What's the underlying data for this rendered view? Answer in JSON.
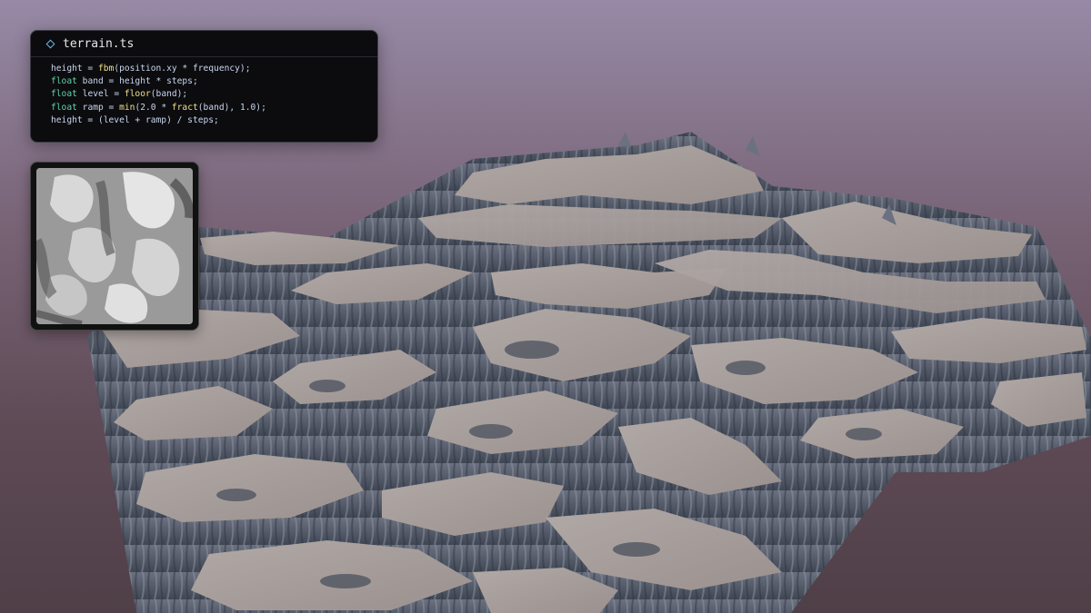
{
  "editor": {
    "filename": "terrain.ts",
    "file_icon": "diamond-icon",
    "lines": [
      [
        {
          "t": "height",
          "c": "id"
        },
        {
          "t": " = ",
          "c": "op"
        },
        {
          "t": "fbm",
          "c": "fn"
        },
        {
          "t": "(position.xy * frequency);",
          "c": "id"
        }
      ],
      [
        {
          "t": "float",
          "c": "kw"
        },
        {
          "t": " band = height * steps;",
          "c": "id"
        }
      ],
      [
        {
          "t": "float",
          "c": "kw"
        },
        {
          "t": " level = ",
          "c": "id"
        },
        {
          "t": "floor",
          "c": "fn"
        },
        {
          "t": "(band);",
          "c": "id"
        }
      ],
      [
        {
          "t": "float",
          "c": "kw"
        },
        {
          "t": " ramp = ",
          "c": "id"
        },
        {
          "t": "min",
          "c": "fn"
        },
        {
          "t": "(2.0 * ",
          "c": "id"
        },
        {
          "t": "fract",
          "c": "fn"
        },
        {
          "t": "(band), 1.0);",
          "c": "id"
        }
      ],
      [
        {
          "t": "height",
          "c": "id"
        },
        {
          "t": " = (level + ramp) / steps;",
          "c": "id"
        }
      ]
    ]
  },
  "colors": {
    "sky_top": "#978aa6",
    "sky_bottom": "#4f3f47",
    "plateau": "#a49c99",
    "cliff": "#545b6a",
    "shadow": "#3f4654",
    "keyword": "#5fd4a6",
    "function": "#f0e08a",
    "identifier": "#c8d6ee",
    "icon_accent": "#6fb6e6"
  }
}
